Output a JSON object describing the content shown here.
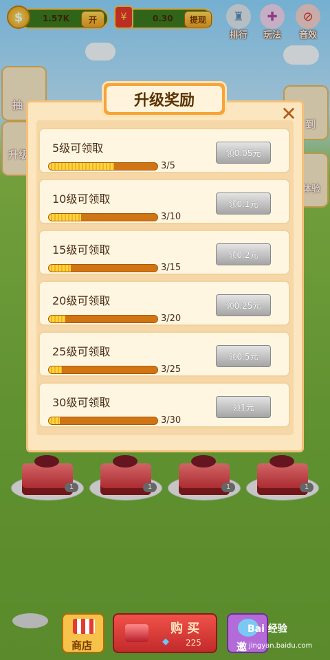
{
  "topbar": {
    "coins": "1.57K",
    "open_label": "开",
    "cash": "0.30",
    "withdraw_label": "提现",
    "icons": [
      {
        "label": "排行",
        "icon": "trophy-icon"
      },
      {
        "label": "玩法",
        "icon": "gamepad-icon"
      },
      {
        "label": "音效",
        "icon": "mute-icon"
      }
    ]
  },
  "side": {
    "left": [
      {
        "label": "抽"
      },
      {
        "label": "升级"
      }
    ],
    "right": [
      {
        "label": "到"
      },
      {
        "label": "体验"
      }
    ]
  },
  "dialog": {
    "title": "升级奖励",
    "rows": [
      {
        "name": "5级可领取",
        "progress": "3/5",
        "fraction": 0.6,
        "button": "领0.05元"
      },
      {
        "name": "10级可领取",
        "progress": "3/10",
        "fraction": 0.3,
        "button": "领0.1元"
      },
      {
        "name": "15级可领取",
        "progress": "3/15",
        "fraction": 0.2,
        "button": "领0.2元"
      },
      {
        "name": "20级可领取",
        "progress": "3/20",
        "fraction": 0.15,
        "button": "领0.25元"
      },
      {
        "name": "25级可领取",
        "progress": "3/25",
        "fraction": 0.12,
        "button": "领0.5元"
      },
      {
        "name": "30级可领取",
        "progress": "3/30",
        "fraction": 0.1,
        "button": "领1元"
      }
    ]
  },
  "cakes": [
    {
      "level": "1"
    },
    {
      "level": "1"
    },
    {
      "level": "1"
    },
    {
      "level": "1"
    }
  ],
  "bottom": {
    "shop_label": "商店",
    "buy_label": "购 买",
    "price": "225",
    "invite_label": "邀"
  },
  "watermark": {
    "brand": "Bai 经验",
    "url": "jingyan.baidu.com"
  }
}
